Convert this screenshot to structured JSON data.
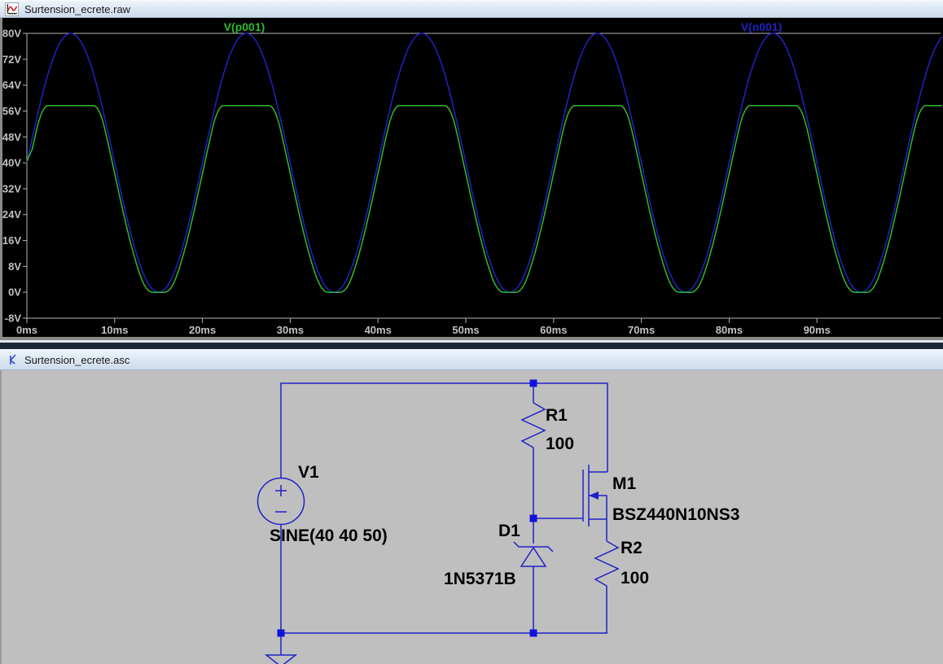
{
  "window": {
    "waveform_pane": {
      "title": "Surtension_ecrete.raw"
    },
    "schematic_pane": {
      "title": "Surtension_ecrete.asc"
    }
  },
  "chart_data": {
    "type": "line",
    "background": "#000000",
    "axis_color": "#b4b4b4",
    "tick_label_color": "#c2c2c2",
    "grid": false,
    "x_unit": "ms",
    "y_unit": "V",
    "x_range_ms": [
      0,
      104.3
    ],
    "y_range_v": [
      -8,
      80
    ],
    "x_tick_step_ms": 10,
    "y_tick_step_v": 8,
    "x_ticks": [
      {
        "t": 0,
        "label": "0ms"
      },
      {
        "t": 10,
        "label": "10ms"
      },
      {
        "t": 20,
        "label": "20ms"
      },
      {
        "t": 30,
        "label": "30ms"
      },
      {
        "t": 40,
        "label": "40ms"
      },
      {
        "t": 50,
        "label": "50ms"
      },
      {
        "t": 60,
        "label": "60ms"
      },
      {
        "t": 70,
        "label": "70ms"
      },
      {
        "t": 80,
        "label": "80ms"
      },
      {
        "t": 90,
        "label": "90ms"
      }
    ],
    "y_ticks": [
      {
        "v": 80,
        "label": "80V"
      },
      {
        "v": 72,
        "label": "72V"
      },
      {
        "v": 64,
        "label": "64V"
      },
      {
        "v": 56,
        "label": "56V"
      },
      {
        "v": 48,
        "label": "48V"
      },
      {
        "v": 40,
        "label": "40V"
      },
      {
        "v": 32,
        "label": "32V"
      },
      {
        "v": 24,
        "label": "24V"
      },
      {
        "v": 16,
        "label": "16V"
      },
      {
        "v": 8,
        "label": "8V"
      },
      {
        "v": 0,
        "label": "0V"
      },
      {
        "v": -8,
        "label": "-8V"
      }
    ],
    "series": [
      {
        "name": "V(p001)",
        "color": "#2dbb2d",
        "model": "clipped-sine",
        "offset_v": 40,
        "amplitude_v": 40,
        "frequency_hz": 50,
        "follower_drop_v": 3.3,
        "clip_max_v": 57.7,
        "clip_min_v": 0
      },
      {
        "name": "V(n001)",
        "color": "#2121c4",
        "model": "sine",
        "offset_v": 40,
        "amplitude_v": 40,
        "frequency_hz": 50
      }
    ]
  },
  "schematic": {
    "components": [
      {
        "ref": "V1",
        "value": "SINE(40 40 50)",
        "type": "voltage-source"
      },
      {
        "ref": "R1",
        "value": "100",
        "type": "resistor"
      },
      {
        "ref": "M1",
        "value": "BSZ440N10NS3",
        "type": "nmos-transistor"
      },
      {
        "ref": "D1",
        "value": "1N5371B",
        "type": "zener-diode"
      },
      {
        "ref": "R2",
        "value": "100",
        "type": "resistor"
      }
    ]
  }
}
